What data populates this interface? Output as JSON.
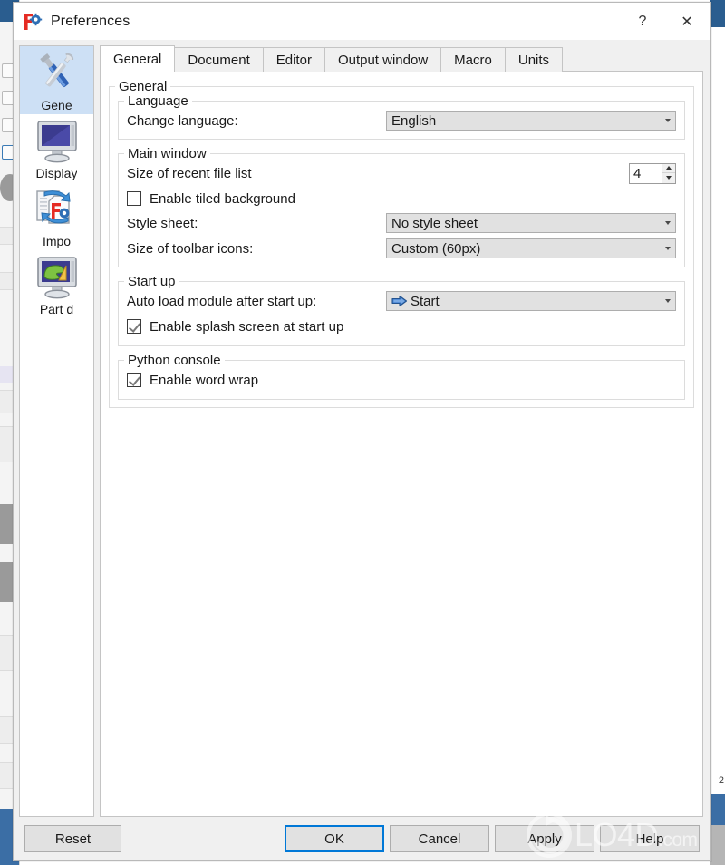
{
  "window": {
    "title": "Preferences",
    "icon": "freecad-preferences-icon",
    "help_button": "?",
    "close_button": "✕"
  },
  "sidebar": {
    "items": [
      {
        "label": "Gene",
        "full": "General",
        "icon": "tools-wrench-screwdriver-icon",
        "selected": true
      },
      {
        "label": "Display",
        "full": "Display",
        "icon": "monitor-icon",
        "selected": false
      },
      {
        "label": "Impo",
        "full": "Import-Export",
        "icon": "import-export-icon",
        "selected": false
      },
      {
        "label": "Part d",
        "full": "Part design",
        "icon": "part-design-monitor-icon",
        "selected": false
      }
    ]
  },
  "tabs": [
    {
      "label": "General",
      "active": true
    },
    {
      "label": "Document",
      "active": false
    },
    {
      "label": "Editor",
      "active": false
    },
    {
      "label": "Output window",
      "active": false
    },
    {
      "label": "Macro",
      "active": false
    },
    {
      "label": "Units",
      "active": false
    }
  ],
  "page": {
    "outer_group_title": "General",
    "groups": {
      "language": {
        "title": "Language",
        "change_language_label": "Change language:",
        "change_language_value": "English"
      },
      "main_window": {
        "title": "Main window",
        "recent_files_label": "Size of recent file list",
        "recent_files_value": "4",
        "tiled_background_label": "Enable tiled background",
        "tiled_background_checked": false,
        "style_sheet_label": "Style sheet:",
        "style_sheet_value": "No style sheet",
        "toolbar_icons_label": "Size of toolbar icons:",
        "toolbar_icons_value": "Custom (60px)"
      },
      "start_up": {
        "title": "Start up",
        "auto_load_label": "Auto load module after start up:",
        "auto_load_value": "Start",
        "auto_load_icon": "blue-right-arrow-icon",
        "splash_label": "Enable splash screen at start up",
        "splash_checked": true
      },
      "python_console": {
        "title": "Python console",
        "word_wrap_label": "Enable word wrap",
        "word_wrap_checked": true
      }
    }
  },
  "footer": {
    "reset": "Reset",
    "ok": "OK",
    "cancel": "Cancel",
    "apply": "Apply",
    "help": "Help"
  },
  "watermark": {
    "name": "LO4D",
    "suffix": ".com",
    "logo": "circular-arrow-logo"
  },
  "background": {
    "right_edge_text": "2"
  },
  "colors": {
    "accent": "#0078d7",
    "selection": "#cde0f5",
    "titlebar_blue": "#2a5d8f",
    "control_face": "#e1e1e1",
    "border": "#c4c4c4"
  }
}
